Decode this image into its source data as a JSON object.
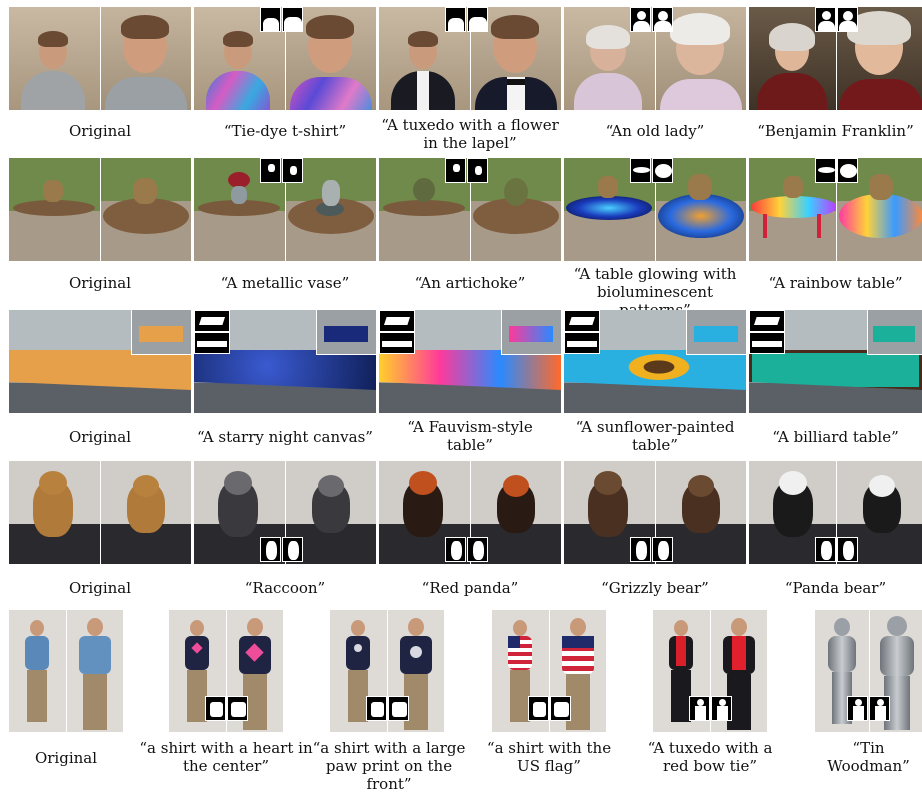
{
  "rows": [
    {
      "captions": [
        "Original",
        "“Tie-dye t-shirt”",
        "“A tuxedo with a flower in the lapel”",
        "“An old lady”",
        "“Benjamin Franklin”"
      ]
    },
    {
      "captions": [
        "Original",
        "“A metallic vase”",
        "“An artichoke”",
        "“A table glowing with bioluminescent patterns”",
        "“A rainbow table”"
      ]
    },
    {
      "captions": [
        "Original",
        "“A starry night canvas”",
        "“A Fauvism-style table”",
        "“A sunflower-painted table”",
        "“A billiard table”"
      ]
    },
    {
      "captions": [
        "Original",
        "“Raccoon”",
        "“Red panda”",
        "“Grizzly bear”",
        "“Panda bear”"
      ]
    },
    {
      "captions": [
        "Original",
        "“a shirt with a heart in the center”",
        "“a shirt with a large paw print on the front”",
        "“a shirt with the US flag”",
        "“A tuxedo with a red bow tie”",
        "“Tin Woodman”"
      ]
    }
  ],
  "colors": {
    "background": "#ffffff",
    "mask_bg": "#000000",
    "mask_fg": "#ffffff"
  }
}
